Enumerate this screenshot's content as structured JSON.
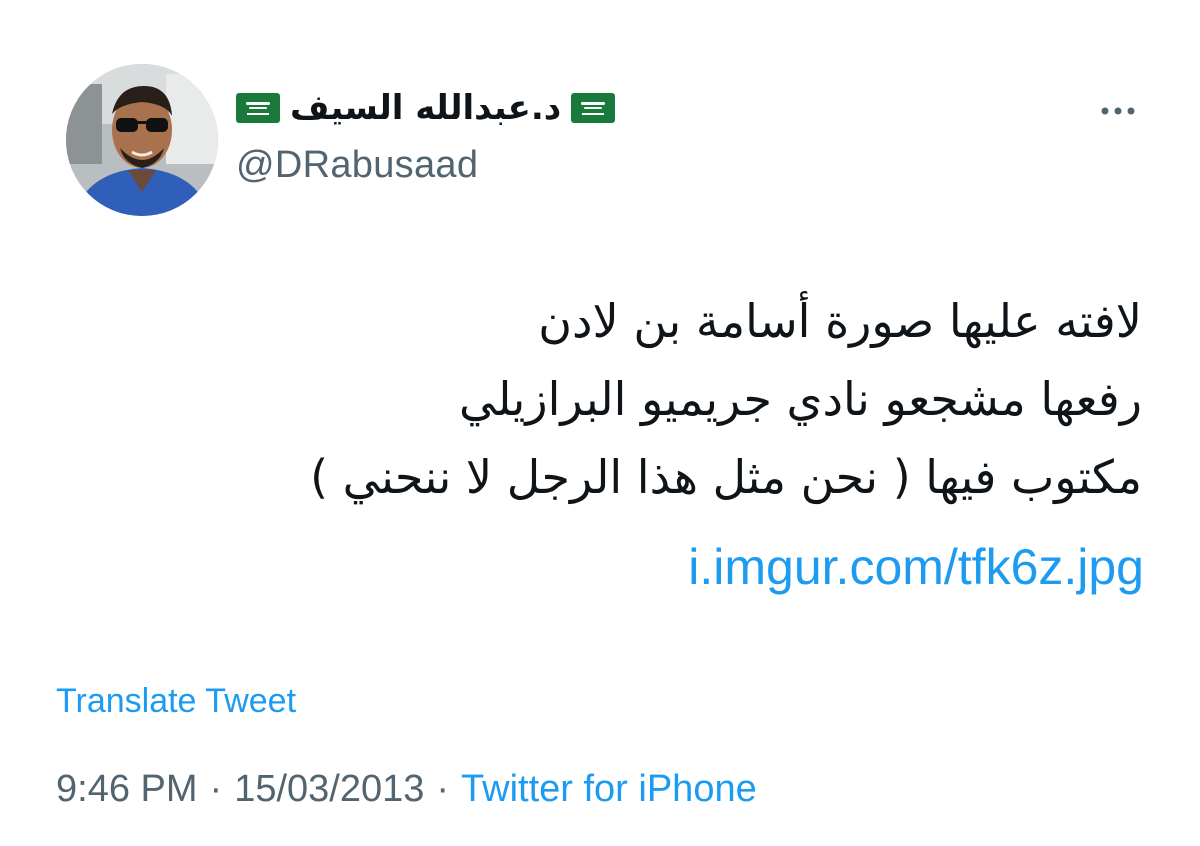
{
  "user": {
    "display_name": "د.عبدالله السيف",
    "handle": "@DRabusaad",
    "flag_emoji_name": "saudi-arabia-flag",
    "flag_color": "#1a7a3c"
  },
  "tweet": {
    "lines": [
      "لافته عليها صورة أسامة بن لادن",
      "رفعها مشجعو نادي جريميو البرازيلي",
      "مكتوب فيها ( نحن مثل هذا الرجل لا ننحني )"
    ],
    "link": "i.imgur.com/tfk6z.jpg"
  },
  "translate_label": "Translate Tweet",
  "meta": {
    "time": "9:46 PM",
    "date": "15/03/2013",
    "separator": "·",
    "source": "Twitter for iPhone"
  },
  "colors": {
    "accent": "#1d9bf0",
    "secondary_text": "#536471",
    "primary_text": "#0f1419"
  },
  "icons": {
    "more": "more-horizontal-icon"
  }
}
